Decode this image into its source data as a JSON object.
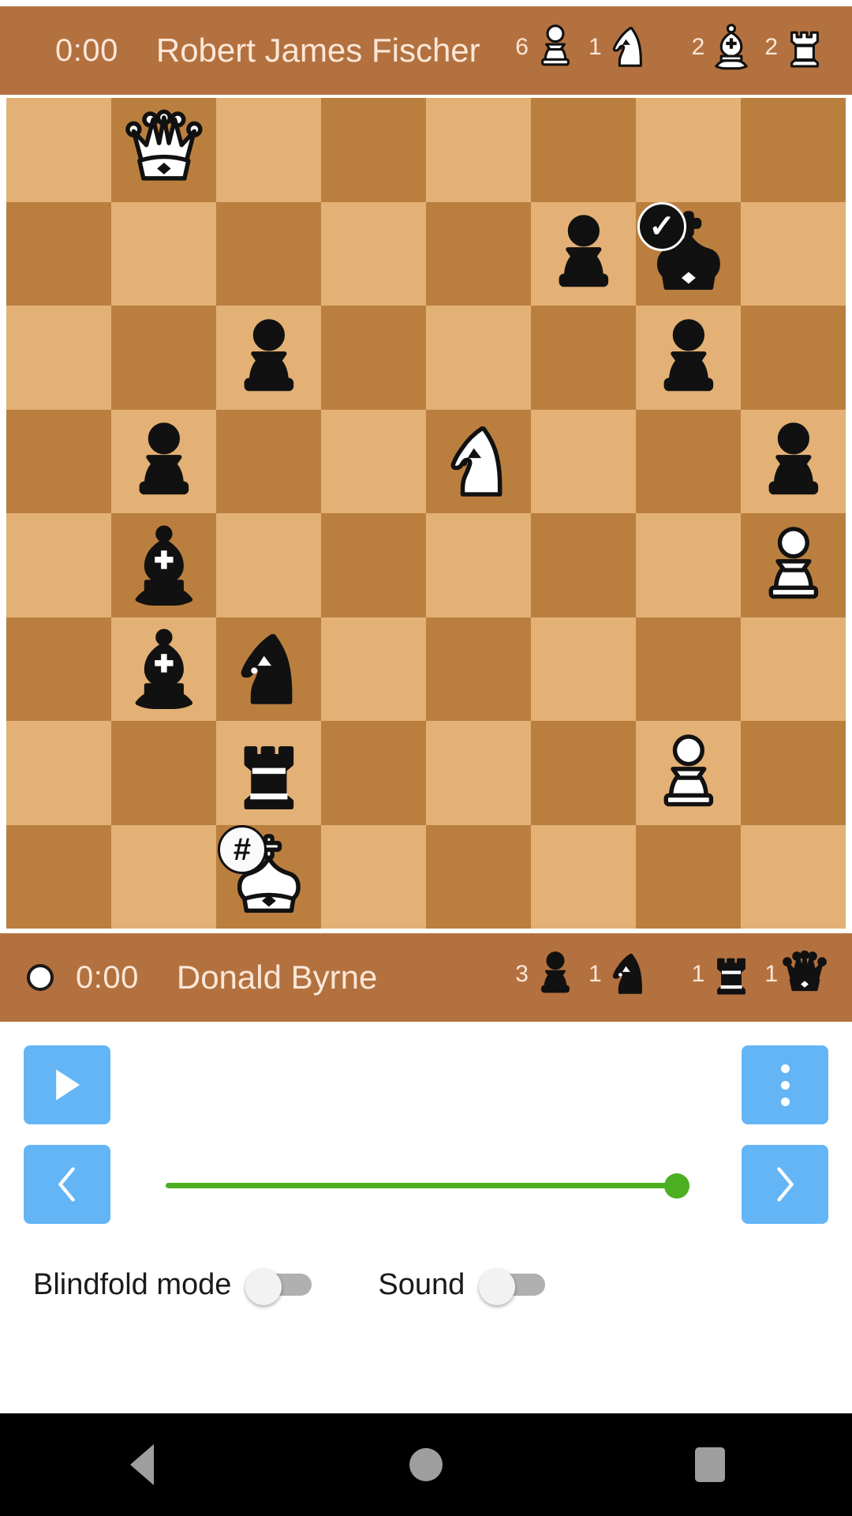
{
  "top_player": {
    "clock": "0:00",
    "name": "Robert James Fischer",
    "turn_indicator": false,
    "captured": [
      {
        "piece": "white-pawn",
        "count": "6"
      },
      {
        "piece": "white-knight",
        "count": "1"
      },
      {
        "piece": "white-bishop",
        "count": "2"
      },
      {
        "piece": "white-rook",
        "count": "2"
      }
    ]
  },
  "bottom_player": {
    "clock": "0:00",
    "name": "Donald Byrne",
    "turn_indicator": true,
    "captured": [
      {
        "piece": "black-pawn",
        "count": "3"
      },
      {
        "piece": "black-knight",
        "count": "1"
      },
      {
        "piece": "black-rook",
        "count": "1"
      },
      {
        "piece": "black-queen",
        "count": "1"
      }
    ]
  },
  "board": {
    "orientation": "white-bottom",
    "light_square_color": "#e3b175",
    "dark_square_color": "#ba7f3f",
    "ranks": [
      [
        null,
        "wQ",
        null,
        null,
        null,
        null,
        null,
        null
      ],
      [
        null,
        null,
        null,
        null,
        null,
        "bP",
        "bK",
        null
      ],
      [
        null,
        null,
        "bP",
        null,
        null,
        null,
        "bP",
        null
      ],
      [
        null,
        "bP",
        null,
        null,
        "wN",
        null,
        null,
        "bP"
      ],
      [
        null,
        "bB",
        null,
        null,
        null,
        null,
        null,
        "wP"
      ],
      [
        null,
        "bB",
        "bN",
        null,
        null,
        null,
        null,
        null
      ],
      [
        null,
        null,
        "bR",
        null,
        null,
        null,
        "wP",
        null
      ],
      [
        null,
        null,
        "wK",
        null,
        null,
        null,
        null,
        null
      ]
    ],
    "badges": [
      {
        "square": "g7",
        "symbol": "✓",
        "style": "dark-badge",
        "name": "check-badge"
      },
      {
        "square": "c1",
        "symbol": "#",
        "style": "light-badge",
        "name": "checkmate-badge"
      }
    ]
  },
  "controls": {
    "play_label": "play",
    "menu_label": "more-options",
    "prev_label": "previous-move",
    "next_label": "next-move",
    "slider": {
      "value": "100",
      "min": "0",
      "max": "100",
      "color": "#4caf22"
    }
  },
  "settings": {
    "blindfold_label": "Blindfold mode",
    "blindfold_on": false,
    "sound_label": "Sound",
    "sound_on": false
  },
  "navbar": {
    "back": "back",
    "home": "home",
    "recents": "recents"
  },
  "colors": {
    "bar_background": "#b3713f",
    "bar_text": "#fbe7d8",
    "button_blue": "#64b5f6",
    "slider_green": "#4caf22"
  }
}
